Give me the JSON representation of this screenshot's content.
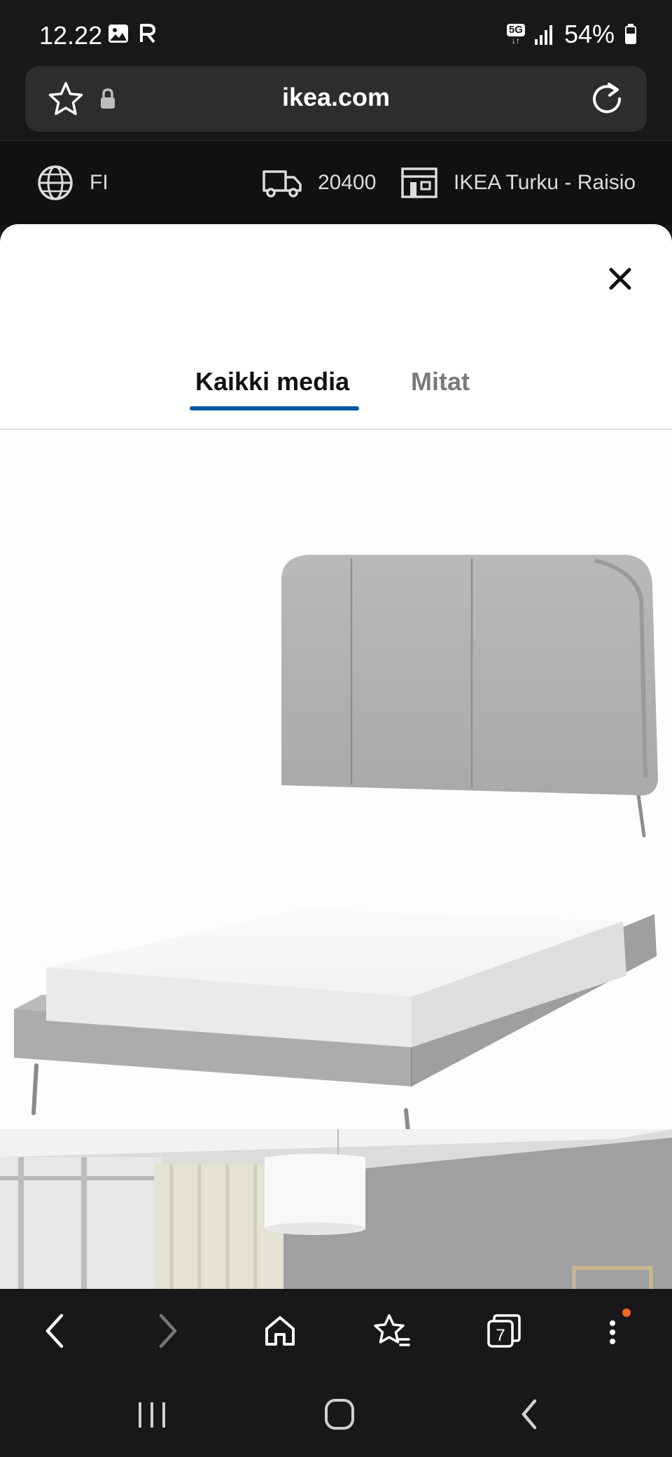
{
  "status_bar": {
    "time": "12.22",
    "battery": "54%",
    "network": "5G"
  },
  "browser": {
    "url": "ikea.com"
  },
  "site_header": {
    "language": "FI",
    "postal_code": "20400",
    "store": "IKEA Turku - Raisio"
  },
  "media_viewer": {
    "tabs": [
      {
        "label": "Kaikki media",
        "active": true
      },
      {
        "label": "Mitat",
        "active": false
      }
    ]
  },
  "bottom_nav": {
    "tab_count": "7"
  },
  "colors": {
    "accent": "#0058a3",
    "notification_dot": "#f26722"
  }
}
